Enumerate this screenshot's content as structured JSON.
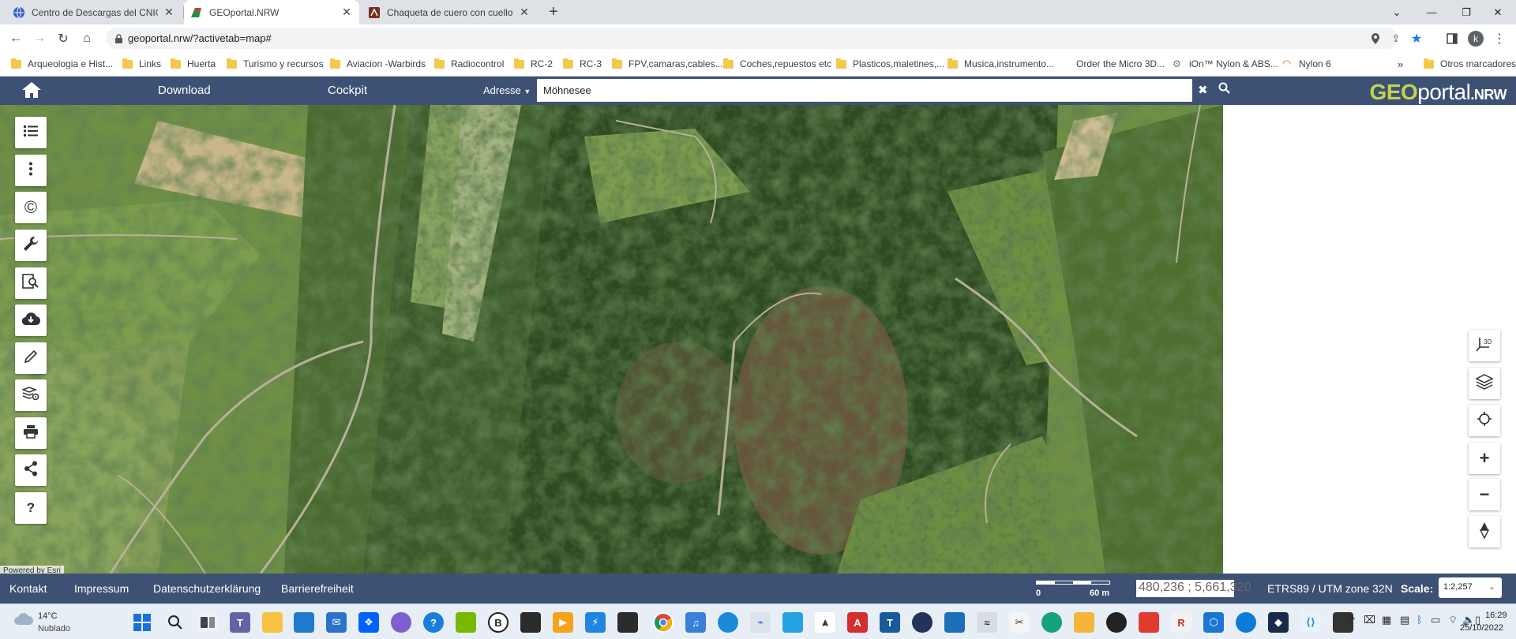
{
  "browser": {
    "tabs": [
      {
        "title": "Centro de Descargas del CNIG (I",
        "active": false
      },
      {
        "title": "GEOportal.NRW",
        "active": true
      },
      {
        "title": "Chaqueta de cuero con cuello al",
        "active": false
      }
    ],
    "new_tab_label": "+",
    "url": "geoportal.nrw/?activetab=map#",
    "profile_initial": "k",
    "bookmarks": [
      "Arqueologia e Hist...",
      "Links",
      "Huerta",
      "Turismo y recursos",
      "Aviacion -Warbirds",
      "Radiocontrol",
      "RC-2",
      "RC-3",
      "FPV,camaras,cables...",
      "Coches,repuestos etc",
      "Plasticos,maletines,...",
      "Musica,instrumento...",
      "Order the Micro 3D...",
      "iOn™ Nylon & ABS...",
      "Nylon 6"
    ],
    "bookmarks_overflow": "»",
    "other_bookmarks": "Otros marcadores"
  },
  "app": {
    "nav": {
      "download": "Download",
      "cockpit": "Cockpit"
    },
    "search_type": "Adresse",
    "search_value": "Möhnesee",
    "logo": {
      "geo": "GEO",
      "portal": "portal",
      "nrw": ".NRW"
    },
    "map_attribution": "Powered by Esri",
    "left_tools": [
      {
        "name": "list-icon",
        "glyph": "☰"
      },
      {
        "name": "more-vertical-icon",
        "glyph": "⋮"
      },
      {
        "name": "copyright-icon",
        "glyph": "©"
      },
      {
        "name": "wrench-icon",
        "glyph": "🔧"
      },
      {
        "name": "search-document-icon",
        "glyph": "🔍"
      },
      {
        "name": "cloud-download-icon",
        "glyph": "⬇"
      },
      {
        "name": "pencil-icon",
        "glyph": "✎"
      },
      {
        "name": "layers-settings-icon",
        "glyph": "≋"
      },
      {
        "name": "print-icon",
        "glyph": "🖶"
      },
      {
        "name": "share-icon",
        "glyph": "⤤"
      },
      {
        "name": "help-icon",
        "glyph": "?"
      }
    ],
    "right_tools": [
      {
        "name": "3d-view-icon",
        "glyph": "3D"
      },
      {
        "name": "layers-icon",
        "glyph": "◈"
      },
      {
        "name": "locate-icon",
        "glyph": "⌖"
      },
      {
        "name": "zoom-in-icon",
        "glyph": "+"
      },
      {
        "name": "zoom-out-icon",
        "glyph": "−"
      },
      {
        "name": "compass-icon",
        "glyph": "⬧"
      }
    ],
    "footer": {
      "links": [
        "Kontakt",
        "Impressum",
        "Datenschutzerklärung",
        "Barrierefreiheit"
      ],
      "scalebar_start": "0",
      "scalebar_end": "60 m",
      "coordinates": "480,236 ; 5,661,320",
      "projection": "ETRS89 / UTM zone 32N",
      "scale_label": "Scale:",
      "scale_value": "1:2,257"
    }
  },
  "taskbar": {
    "weather_temp": "14°C",
    "weather_desc": "Nublado",
    "time": "16:29",
    "date": "25/10/2022"
  },
  "colors": {
    "app_header": "#3d5174",
    "logo_geo": "#c2d44c",
    "tabstrip": "#dee1e6"
  }
}
